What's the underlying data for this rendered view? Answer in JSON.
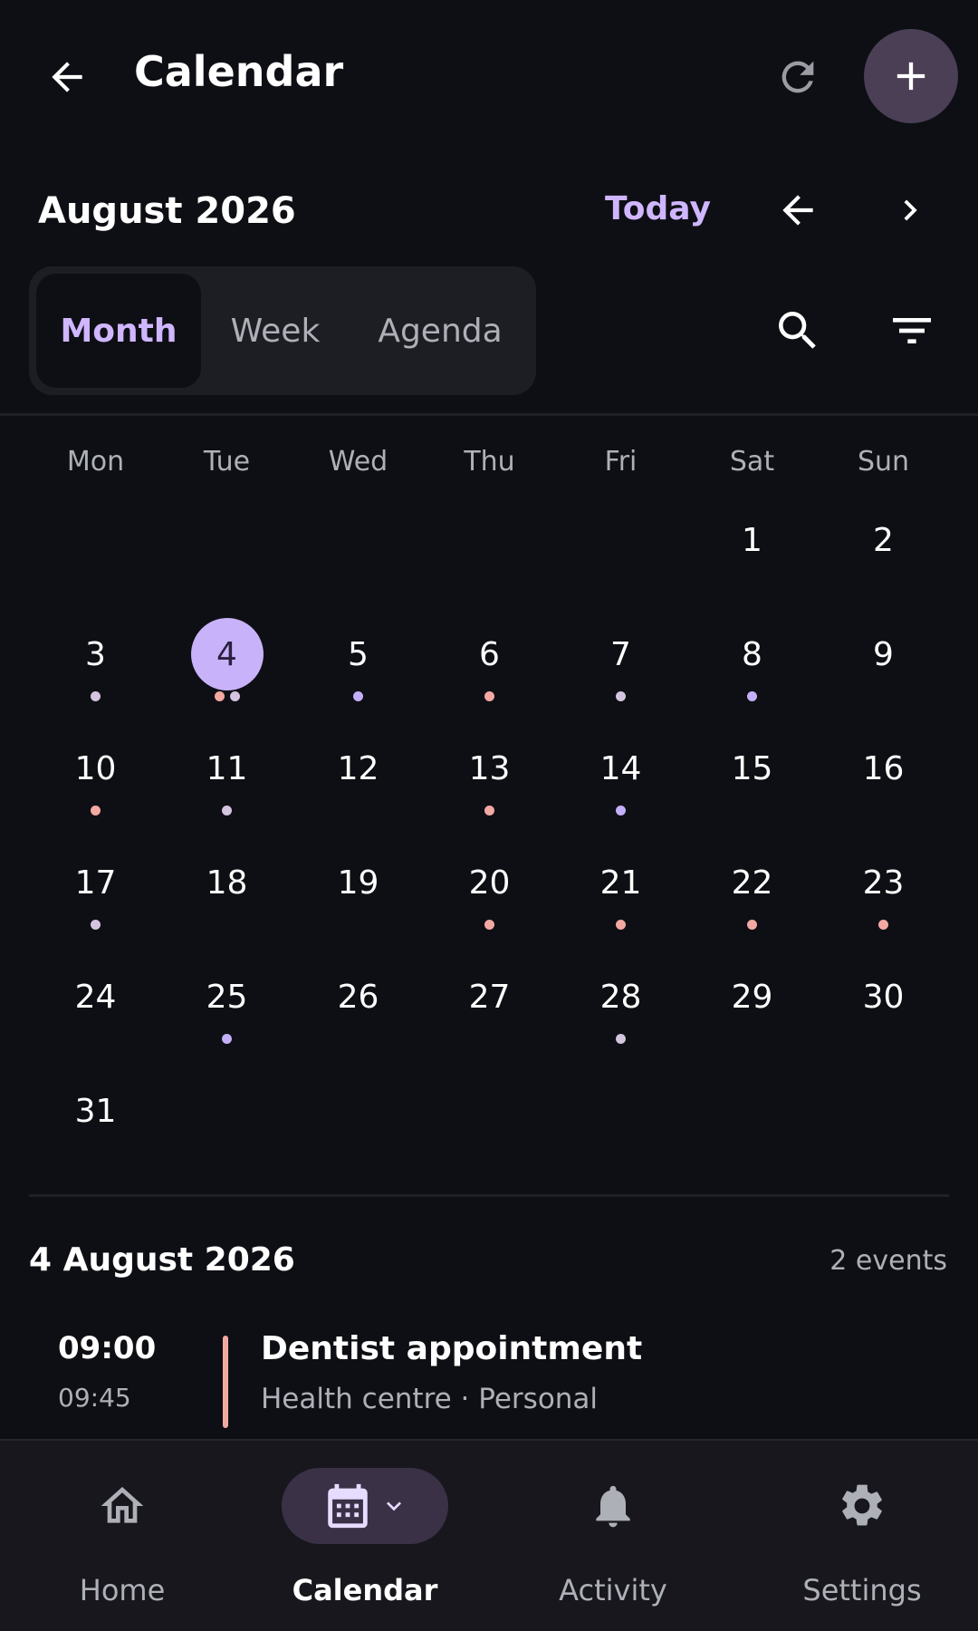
{
  "app_bar": {
    "title": "Calendar",
    "back_icon": "arrow-left-icon",
    "refresh_icon": "refresh-icon",
    "add_icon": "plus-icon"
  },
  "header": {
    "month": "August 2026",
    "today_label": "Today"
  },
  "view_tabs": [
    {
      "label": "Month",
      "active": true
    },
    {
      "label": "Week",
      "active": false
    },
    {
      "label": "Agenda",
      "active": false
    }
  ],
  "weekdays": [
    "Mon",
    "Tue",
    "Wed",
    "Thu",
    "Fri",
    "Sat",
    "Sun"
  ],
  "calendar": {
    "first_weekday_index": 5,
    "days": [
      {
        "d": "1",
        "dots": []
      },
      {
        "d": "2",
        "dots": []
      },
      {
        "d": "3",
        "dots": [
          "lavender"
        ]
      },
      {
        "d": "4",
        "dots": [
          "salmon",
          "lavender"
        ],
        "selected": true
      },
      {
        "d": "5",
        "dots": [
          "purple"
        ]
      },
      {
        "d": "6",
        "dots": [
          "salmon"
        ]
      },
      {
        "d": "7",
        "dots": [
          "lavender"
        ]
      },
      {
        "d": "8",
        "dots": [
          "purple"
        ]
      },
      {
        "d": "9",
        "dots": []
      },
      {
        "d": "10",
        "dots": [
          "salmon"
        ]
      },
      {
        "d": "11",
        "dots": [
          "lavender"
        ]
      },
      {
        "d": "12",
        "dots": []
      },
      {
        "d": "13",
        "dots": [
          "salmon"
        ]
      },
      {
        "d": "14",
        "dots": [
          "purple"
        ]
      },
      {
        "d": "15",
        "dots": []
      },
      {
        "d": "16",
        "dots": []
      },
      {
        "d": "17",
        "dots": [
          "lavender"
        ]
      },
      {
        "d": "18",
        "dots": []
      },
      {
        "d": "19",
        "dots": []
      },
      {
        "d": "20",
        "dots": [
          "salmon"
        ]
      },
      {
        "d": "21",
        "dots": [
          "salmon"
        ]
      },
      {
        "d": "22",
        "dots": [
          "salmon"
        ]
      },
      {
        "d": "23",
        "dots": [
          "salmon"
        ]
      },
      {
        "d": "24",
        "dots": []
      },
      {
        "d": "25",
        "dots": [
          "purple"
        ]
      },
      {
        "d": "26",
        "dots": []
      },
      {
        "d": "27",
        "dots": []
      },
      {
        "d": "28",
        "dots": [
          "lavender"
        ]
      },
      {
        "d": "29",
        "dots": []
      },
      {
        "d": "30",
        "dots": []
      },
      {
        "d": "31",
        "dots": []
      }
    ]
  },
  "colors": {
    "accent": "#cfb6ff",
    "selected_day": "#c8b3fb",
    "salmon": "#f4a8a2",
    "lavender": "#d4c4e0",
    "purple": "#c4b0f8",
    "event_bar": "#f4a8a2"
  },
  "selected_day": {
    "date": "4 August 2026",
    "count": "2 events"
  },
  "events": [
    {
      "start": "09:00",
      "end": "09:45",
      "title": "Dentist appointment",
      "subtitle": "Health centre · Personal"
    }
  ],
  "bottom_nav": [
    {
      "label": "Home",
      "icon": "home-icon",
      "active": false
    },
    {
      "label": "Calendar",
      "icon": "calendar-icon",
      "active": true
    },
    {
      "label": "Activity",
      "icon": "bell-icon",
      "active": false
    },
    {
      "label": "Settings",
      "icon": "gear-icon",
      "active": false
    }
  ]
}
